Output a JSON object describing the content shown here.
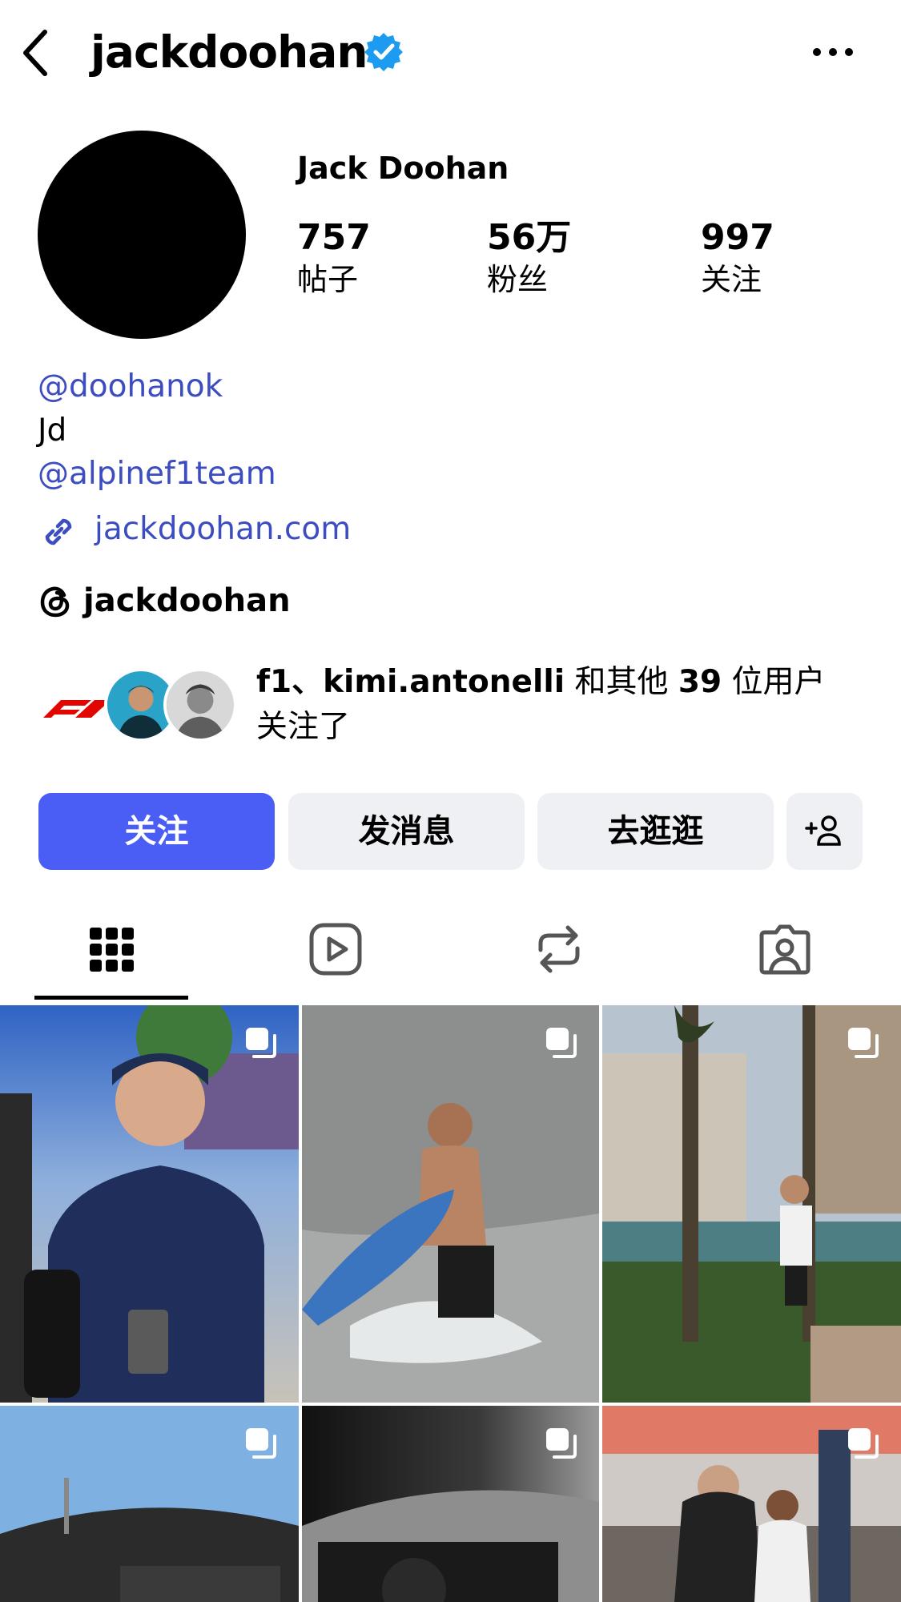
{
  "header": {
    "username": "jackdoohan",
    "verified": true
  },
  "profile": {
    "display_name": "Jack Doohan",
    "stats": [
      {
        "value": "757",
        "label": "帖子"
      },
      {
        "value": "56万",
        "label": "粉丝"
      },
      {
        "value": "997",
        "label": "关注"
      }
    ],
    "bio": {
      "mention_1": "@doohanok",
      "text": "Jd",
      "mention_2": "@alpinef1team",
      "link": "jackdoohan.com"
    },
    "threads_handle": "jackdoohan"
  },
  "followed_by": {
    "text_bold": "f1、kimi.antonelli",
    "text_mid": " 和其他 ",
    "count": "39",
    "text_end": " 位用户关注了"
  },
  "actions": {
    "follow": "关注",
    "message": "发消息",
    "explore": "去逛逛"
  },
  "tabs": [
    "posts-grid-icon",
    "reels-icon",
    "reposts-icon",
    "tagged-icon"
  ],
  "colors": {
    "accent": "#4a5ef5",
    "link": "#3c4cc1",
    "verified": "#1d9bf0",
    "button_bg": "#eff0f3"
  }
}
